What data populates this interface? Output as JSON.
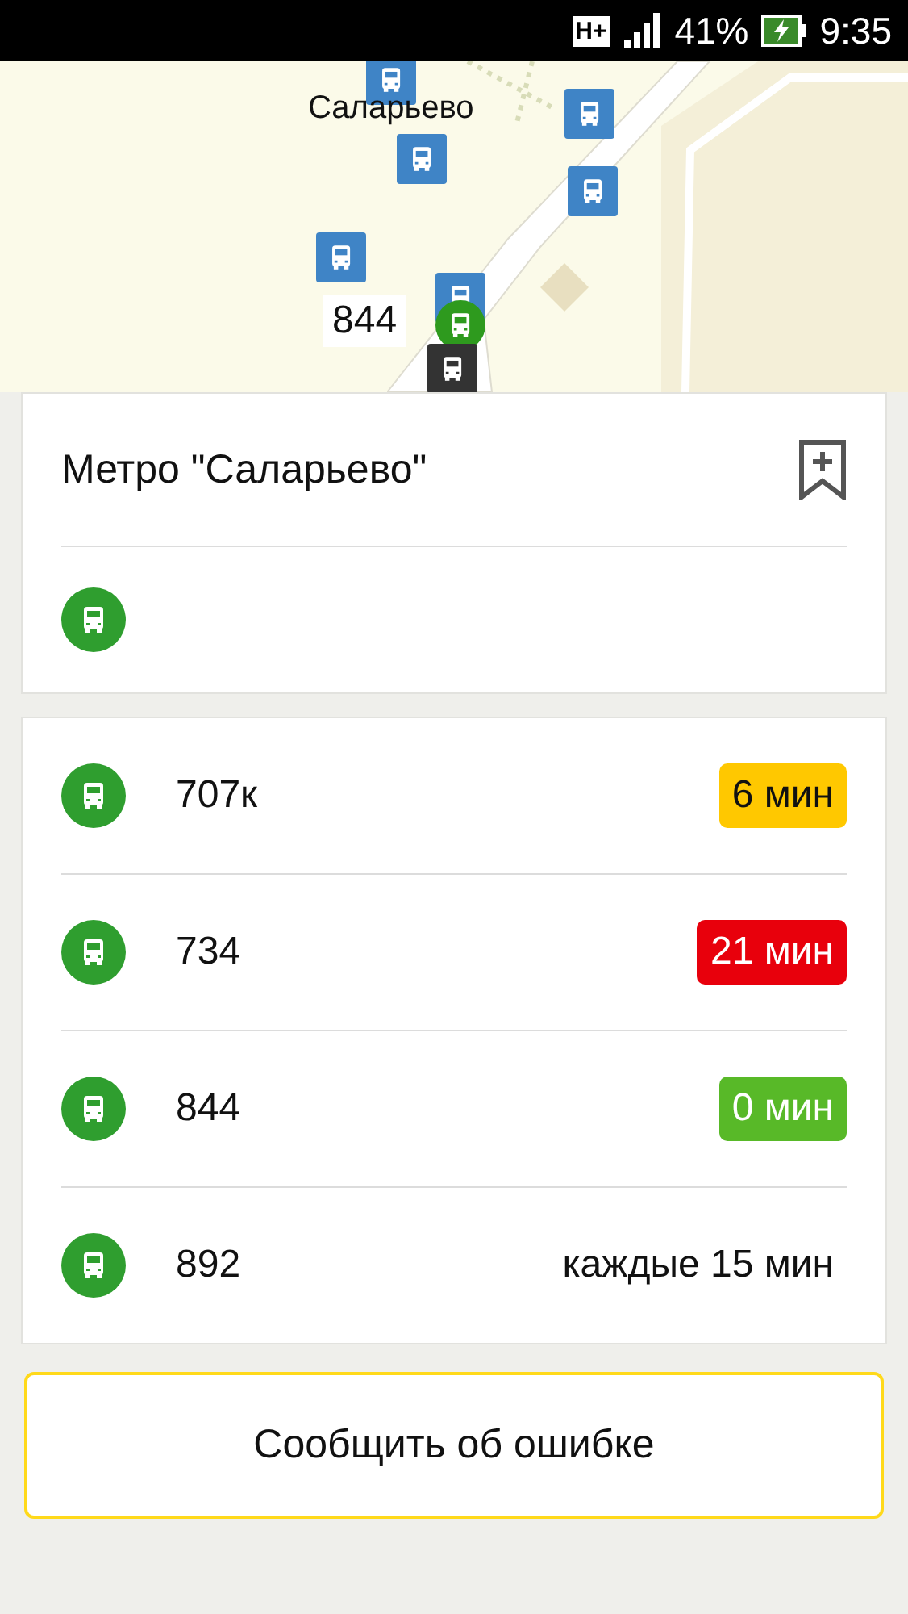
{
  "status_bar": {
    "network": "H+",
    "battery": "41%",
    "time": "9:35"
  },
  "map": {
    "place_label": "Саларьево",
    "vehicle_label": "844"
  },
  "stop": {
    "title": "Метро \"Саларьево\"",
    "bookmarked": false
  },
  "arrivals": [
    {
      "route": "707к",
      "kind": "badge",
      "time": "6 мин",
      "color": "#ffc800"
    },
    {
      "route": "734",
      "kind": "badge",
      "time": "21 мин",
      "color": "#e8000c"
    },
    {
      "route": "844",
      "kind": "badge",
      "time": "0 мин",
      "color": "#58b928"
    },
    {
      "route": "892",
      "kind": "interval",
      "time": "каждые 15 мин"
    }
  ],
  "report_button": "Сообщить об ошибке"
}
